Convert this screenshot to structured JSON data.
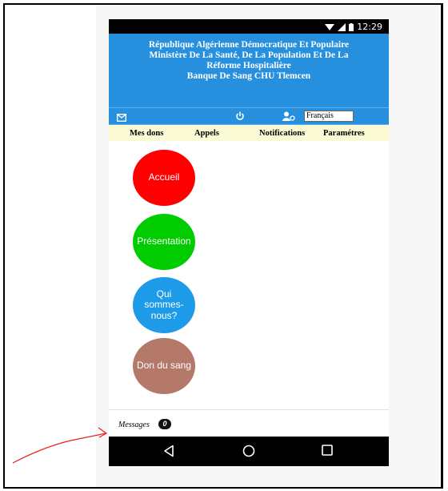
{
  "status_bar": {
    "time": "12:29"
  },
  "header": {
    "lines": [
      "République Algérienne Démocratique Et Populaire",
      "Ministère De La Santé, De La Population Et De La",
      "Réforme Hospitalière",
      "Banque De Sang CHU Tlemcen"
    ]
  },
  "toolbar": {
    "language_selected": "Français",
    "icons": [
      "mail-icon",
      "power-icon",
      "user-settings-icon"
    ]
  },
  "menu": {
    "items": [
      "Mes dons",
      "Appels",
      "Notifications",
      "Paramétres"
    ]
  },
  "circles": [
    {
      "label": "Accueil",
      "color": "#ff0000"
    },
    {
      "label": "Présentation",
      "color": "#00cc00"
    },
    {
      "label": "Qui sommes-nous?",
      "color": "#1e9be8"
    },
    {
      "label": "Don du sang",
      "color": "#b5796a"
    }
  ],
  "messages": {
    "label": "Messages",
    "count": "0"
  },
  "annotation": {
    "arrow_color": "#e8201c"
  },
  "colors": {
    "header_blue": "#2790de",
    "menu_bg": "#fafad4"
  }
}
